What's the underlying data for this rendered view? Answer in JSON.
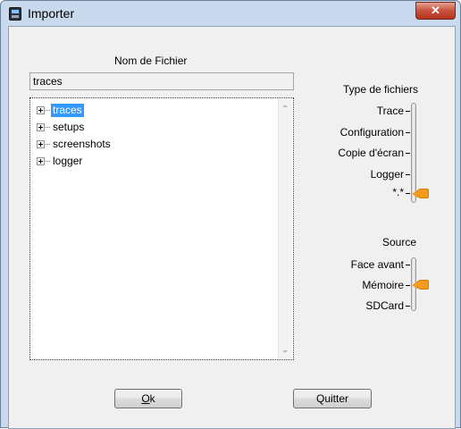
{
  "window": {
    "title": "Importer",
    "close_glyph": "✕",
    "icon": "app-icon"
  },
  "filename": {
    "label": "Nom de Fichier",
    "value": "traces"
  },
  "tree": {
    "items": [
      {
        "label": "traces",
        "selected": true
      },
      {
        "label": "setups",
        "selected": false
      },
      {
        "label": "screenshots",
        "selected": false
      },
      {
        "label": "logger",
        "selected": false
      }
    ]
  },
  "file_type": {
    "label": "Type de fichiers",
    "options": [
      "Trace",
      "Configuration",
      "Copie d'écran",
      "Logger",
      "*.*"
    ],
    "selected": "*.*"
  },
  "source": {
    "label": "Source",
    "options": [
      "Face avant",
      "Mémoire",
      "SDCard"
    ],
    "selected": "Mémoire"
  },
  "buttons": {
    "ok_label": "Ok",
    "ok_mnemonic": "O",
    "ok_rest": "k",
    "quit_label": "Quitter"
  },
  "colors": {
    "selection": "#3399ff",
    "slider_thumb": "#f29b1f",
    "close_button": "#c8523d"
  }
}
